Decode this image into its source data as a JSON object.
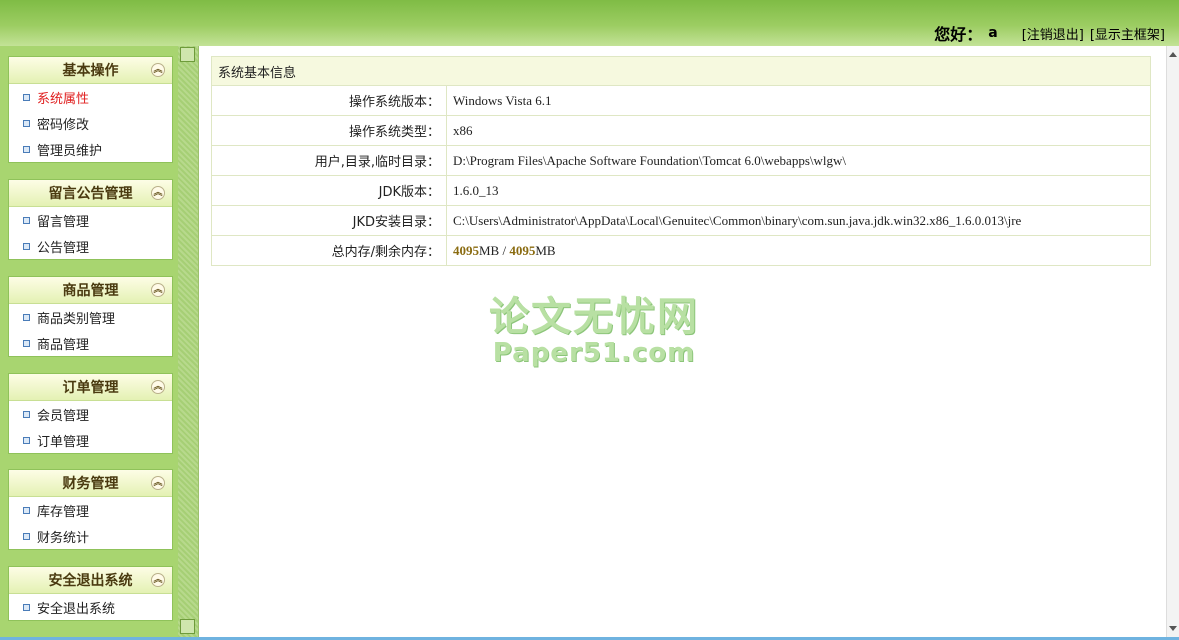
{
  "header": {
    "greeting": "您好：",
    "username": "a",
    "logout_label": "[注销退出]",
    "show_frame_label": "[显示主框架]"
  },
  "sidebar": {
    "groups": [
      {
        "title": "基本操作",
        "items": [
          "系统属性",
          "密码修改",
          "管理员维护"
        ]
      },
      {
        "title": "留言公告管理",
        "items": [
          "留言管理",
          "公告管理"
        ]
      },
      {
        "title": "商品管理",
        "items": [
          "商品类别管理",
          "商品管理"
        ]
      },
      {
        "title": "订单管理",
        "items": [
          "会员管理",
          "订单管理"
        ]
      },
      {
        "title": "财务管理",
        "items": [
          "库存管理",
          "财务统计"
        ]
      },
      {
        "title": "安全退出系统",
        "items": [
          "安全退出系统"
        ]
      }
    ],
    "active_item": "系统属性"
  },
  "info": {
    "title": "系统基本信息",
    "rows": [
      {
        "label": "操作系统版本：",
        "value": "Windows Vista  6.1"
      },
      {
        "label": "操作系统类型：",
        "value": "x86"
      },
      {
        "label": "用户,目录,临时目录：",
        "value": "D:\\Program Files\\Apache Software Foundation\\Tomcat 6.0\\webapps\\wlgw\\"
      },
      {
        "label": "JDK版本：",
        "value": "1.6.0_13"
      },
      {
        "label": "JKD安装目录：",
        "value": "C:\\Users\\Administrator\\AppData\\Local\\Genuitec\\Common\\binary\\com.sun.java.jdk.win32.x86_1.6.0.013\\jre"
      }
    ],
    "memory": {
      "label": "总内存/剩余内存：",
      "total": "4095",
      "free": "4095",
      "unit": "MB",
      "separator": " / "
    }
  },
  "watermark": {
    "cn": "论文无忧网",
    "en": "Paper51.com"
  },
  "colors": {
    "header_green": "#8cc553",
    "sidebar_green": "#a8d570",
    "active_red": "#e02020",
    "memory_gold": "#8a6b10"
  }
}
